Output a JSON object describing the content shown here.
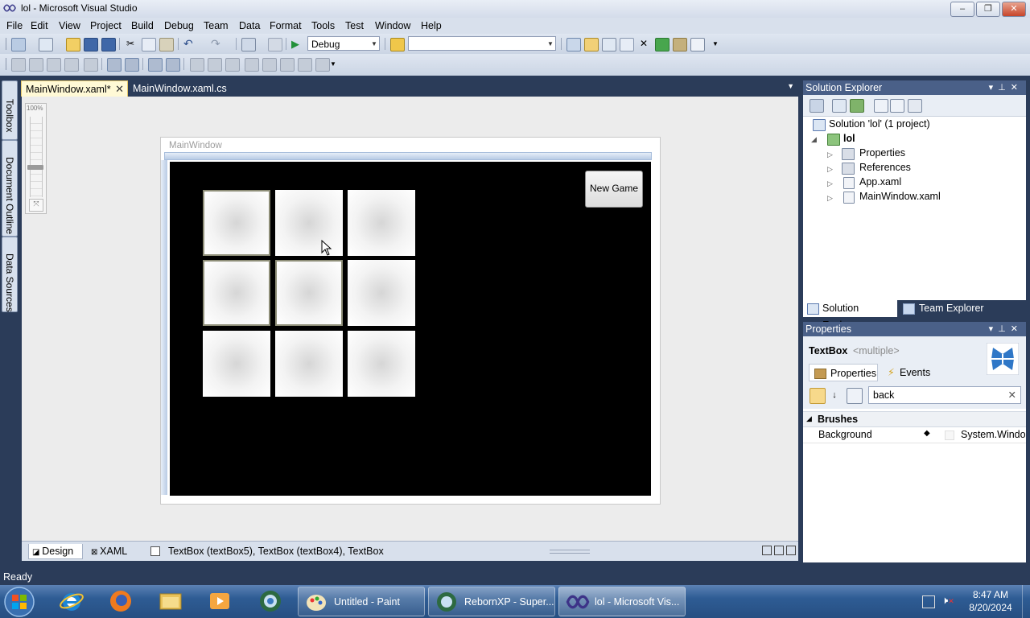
{
  "titlebar": {
    "title": "lol - Microsoft Visual Studio",
    "min": "–",
    "max": "❐",
    "close": "✕"
  },
  "menu": [
    "File",
    "Edit",
    "View",
    "Project",
    "Build",
    "Debug",
    "Team",
    "Data",
    "Format",
    "Tools",
    "Test",
    "Window",
    "Help"
  ],
  "toolbar": {
    "config": "Debug",
    "platform": ""
  },
  "lefttabs": [
    "Toolbox",
    "Document Outline",
    "Data Sources"
  ],
  "doctabs": [
    {
      "label": "MainWindow.xaml*",
      "active": true
    },
    {
      "label": "MainWindow.xaml.cs",
      "active": false
    }
  ],
  "designer": {
    "zoom": "100%",
    "window_title": "MainWindow",
    "new_game": "New Game",
    "grid": {
      "rows": 3,
      "cols": 3
    }
  },
  "designer_bottom": {
    "design": "Design",
    "xaml": "XAML",
    "breadcrumb": "TextBox (textBox5), TextBox (textBox4), TextBox"
  },
  "solution_explorer": {
    "title": "Solution Explorer",
    "items": [
      {
        "label": "Solution 'lol' (1 project)"
      },
      {
        "label": "lol"
      },
      {
        "label": "Properties"
      },
      {
        "label": "References"
      },
      {
        "label": "App.xaml"
      },
      {
        "label": "MainWindow.xaml"
      }
    ],
    "tabs": [
      "Solution Explorer",
      "Team Explorer"
    ]
  },
  "properties": {
    "title": "Properties",
    "type": "TextBox",
    "name": "<multiple>",
    "tab_properties": "Properties",
    "tab_events": "Events",
    "search": "back",
    "category": "Brushes",
    "rows": [
      {
        "name": "Background",
        "value": "System.Windo"
      }
    ]
  },
  "status": "Ready",
  "taskbar": {
    "apps": [
      "Untitled - Paint",
      "RebornXP - Super...",
      "lol - Microsoft Vis..."
    ],
    "time": "8:47 AM",
    "date": "8/20/2024"
  },
  "colors": {
    "accent": "#4a6088",
    "ide_bg": "#2b3c59",
    "canvas": "#000000"
  }
}
